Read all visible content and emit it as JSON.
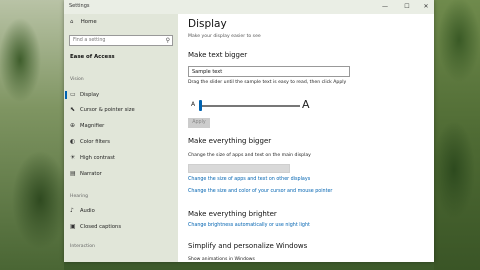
{
  "window": {
    "title": "Settings",
    "controls": {
      "minimize": "—",
      "maximize": "☐",
      "close": "✕"
    }
  },
  "sidebar": {
    "home": {
      "icon": "home-icon",
      "label": "Home"
    },
    "search": {
      "placeholder": "Find a setting",
      "icon": "search-icon"
    },
    "section_title": "Ease of Access",
    "groups": [
      {
        "label": "Vision"
      },
      {
        "label": "Hearing"
      },
      {
        "label": "Interaction"
      }
    ],
    "vision_items": [
      {
        "label": "Display",
        "icon": "display-icon",
        "active": true
      },
      {
        "label": "Cursor & pointer size",
        "icon": "cursor-icon"
      },
      {
        "label": "Magnifier",
        "icon": "magnifier-icon"
      },
      {
        "label": "Color filters",
        "icon": "color-filters-icon"
      },
      {
        "label": "High contrast",
        "icon": "high-contrast-icon"
      },
      {
        "label": "Narrator",
        "icon": "narrator-icon"
      }
    ],
    "hearing_items": [
      {
        "label": "Audio",
        "icon": "audio-icon"
      },
      {
        "label": "Closed captions",
        "icon": "closed-captions-icon"
      }
    ]
  },
  "content": {
    "title": "Display",
    "subtitle": "Make your display easier to see",
    "text_bigger": {
      "heading": "Make text bigger",
      "sample_text": "Sample text",
      "instruction": "Drag the slider until the sample text is easy to read, then click Apply",
      "slider_small_label": "A",
      "slider_big_label": "A",
      "slider_value": 0.0,
      "apply_label": "Apply"
    },
    "everything_bigger": {
      "heading": "Make everything bigger",
      "description": "Change the size of apps and text on the main display",
      "link_1": "Change the size of apps and text on other displays",
      "link_2": "Change the size and color of your cursor and mouse pointer"
    },
    "everything_brighter": {
      "heading": "Make everything brighter",
      "link": "Change brightness automatically or use night light"
    },
    "simplify": {
      "heading": "Simplify and personalize Windows",
      "animations_label": "Show animations in Windows",
      "toggle_state": "On"
    }
  },
  "colors": {
    "accent": "#0063b1",
    "link": "#0063b1"
  }
}
